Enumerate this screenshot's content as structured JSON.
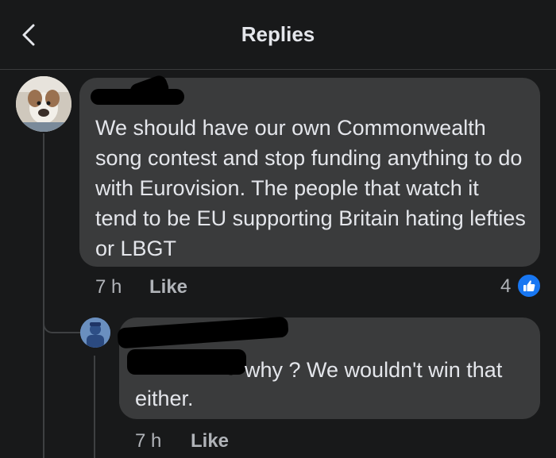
{
  "header": {
    "title": "Replies"
  },
  "comment": {
    "text": "We should have our own Commonwealth song contest and stop funding anything to do with Eurovision. The people that watch it tend to be EU supporting Britain hating lefties or LBGT",
    "time": "7 h",
    "like_label": "Like",
    "reaction_count": "4"
  },
  "reply": {
    "text_line1": "why ? We wouldn't win that",
    "text_line2": "either.",
    "time": "7 h",
    "like_label": "Like"
  },
  "colors": {
    "background": "#18191a",
    "bubble": "#3a3b3c",
    "accent": "#1877f2"
  },
  "icons": [
    "back-arrow-icon",
    "like-icon"
  ]
}
